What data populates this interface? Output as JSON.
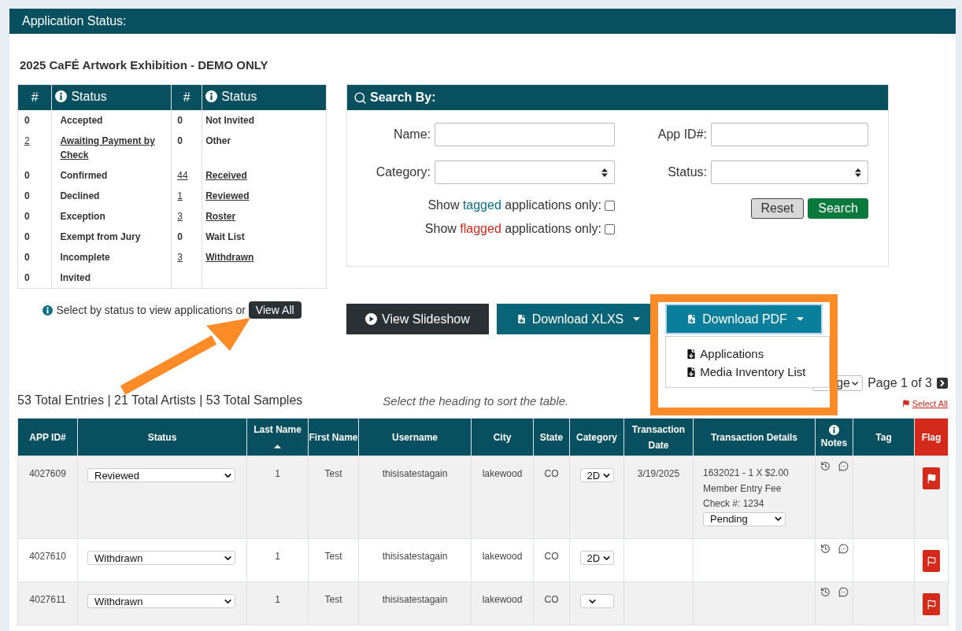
{
  "panel": {
    "title": "Application Status:"
  },
  "exhibition_title": "2025 CaFÉ Artwork Exhibition - DEMO ONLY",
  "status_table": {
    "headers": [
      "#",
      "Status",
      "#",
      "Status"
    ],
    "rows": [
      {
        "left": {
          "count": "0",
          "status": "Accepted",
          "linked": false
        },
        "right": {
          "count": "0",
          "status": "Not Invited",
          "linked": false
        }
      },
      {
        "left": {
          "count": "2",
          "status": "Awaiting Payment by Check",
          "linked": true
        },
        "right": {
          "count": "0",
          "status": "Other",
          "linked": false
        }
      },
      {
        "left": {
          "count": "0",
          "status": "Confirmed",
          "linked": false
        },
        "right": {
          "count": "44",
          "status": "Received",
          "linked": true
        }
      },
      {
        "left": {
          "count": "0",
          "status": "Declined",
          "linked": false
        },
        "right": {
          "count": "1",
          "status": "Reviewed",
          "linked": true
        }
      },
      {
        "left": {
          "count": "0",
          "status": "Exception",
          "linked": false
        },
        "right": {
          "count": "3",
          "status": "Roster",
          "linked": true
        }
      },
      {
        "left": {
          "count": "0",
          "status": "Exempt from Jury",
          "linked": false
        },
        "right": {
          "count": "0",
          "status": "Wait List",
          "linked": false
        }
      },
      {
        "left": {
          "count": "0",
          "status": "Incomplete",
          "linked": false
        },
        "right": {
          "count": "3",
          "status": "Withdrawn",
          "linked": true
        }
      },
      {
        "left": {
          "count": "0",
          "status": "Invited",
          "linked": false
        }
      }
    ]
  },
  "status_hint": {
    "text": "Select by status to view applications or",
    "button": "View All"
  },
  "search": {
    "title": "Search By:",
    "fields": [
      {
        "label": "Name:",
        "kind": "input"
      },
      {
        "label": "App ID#:",
        "kind": "input"
      },
      {
        "label": "Category:",
        "kind": "select"
      },
      {
        "label": "Status:",
        "kind": "select"
      }
    ],
    "checkboxes": [
      {
        "before": "Show ",
        "highlight": "tagged",
        "after": " applications only:",
        "color": "#0e6f86",
        "checked": false
      },
      {
        "before": "Show ",
        "highlight": "flagged",
        "after": " applications only:",
        "color": "#d42a1c",
        "checked": false
      }
    ],
    "buttons": [
      {
        "label": "Reset",
        "kind": "secondary"
      },
      {
        "label": "Search",
        "kind": "primary"
      }
    ]
  },
  "actions": [
    {
      "label": "View Slideshow",
      "kind": "slideshow",
      "caret": false,
      "open": false
    },
    {
      "label": "Download XLXS",
      "kind": "download",
      "caret": true,
      "open": false
    },
    {
      "label": "Download PDF",
      "kind": "download",
      "caret": true,
      "open": true,
      "menu": [
        "Applications",
        "Media Inventory List"
      ]
    }
  ],
  "pager": {
    "per_page": "ge",
    "page": "Page 1 of 3"
  },
  "totals": "53 Total Entries | 21 Total Artists | 53 Total Samples",
  "sort_hint": "Select the heading to sort the table.",
  "select_all": "Select All",
  "table": {
    "columns": [
      {
        "label": "APP ID#",
        "kind": "plain"
      },
      {
        "label": "Status",
        "kind": "plain"
      },
      {
        "label": "Last Name",
        "kind": "sortable",
        "sort_ascending": true
      },
      {
        "label": "First Name",
        "kind": "plain"
      },
      {
        "label": "Username",
        "kind": "plain"
      },
      {
        "label": "City",
        "kind": "plain"
      },
      {
        "label": "State",
        "kind": "plain"
      },
      {
        "label": "Category",
        "kind": "plain"
      },
      {
        "label": "Transaction Date",
        "kind": "plain"
      },
      {
        "label": "Transaction Details",
        "kind": "plain"
      },
      {
        "label": "Notes",
        "kind": "notes"
      },
      {
        "label": "Tag",
        "kind": "plain"
      },
      {
        "label": "Flag",
        "kind": "flag"
      }
    ],
    "rows": [
      {
        "app_id": "4027609",
        "status": "Reviewed",
        "last_name": "1",
        "first_name": "Test",
        "username": "thisisatestagain",
        "city": "lakewood",
        "state": "CO",
        "category": "2D",
        "date": "3/19/2025",
        "details": [
          "1632021 - 1 X $2.00",
          "Member Entry Fee",
          "Check #: 1234"
        ],
        "payment": "Pending",
        "flagged": true
      },
      {
        "app_id": "4027610",
        "status": "Withdrawn",
        "last_name": "1",
        "first_name": "Test",
        "username": "thisisatestagain",
        "city": "lakewood",
        "state": "CO",
        "category": "2D",
        "flagged": false
      },
      {
        "app_id": "4027611",
        "status": "Withdrawn",
        "last_name": "1",
        "first_name": "Test",
        "username": "thisisatestagain",
        "city": "lakewood",
        "state": "CO",
        "flagged": false
      }
    ]
  },
  "callouts": {
    "arrow": true,
    "highlight_box": true
  }
}
